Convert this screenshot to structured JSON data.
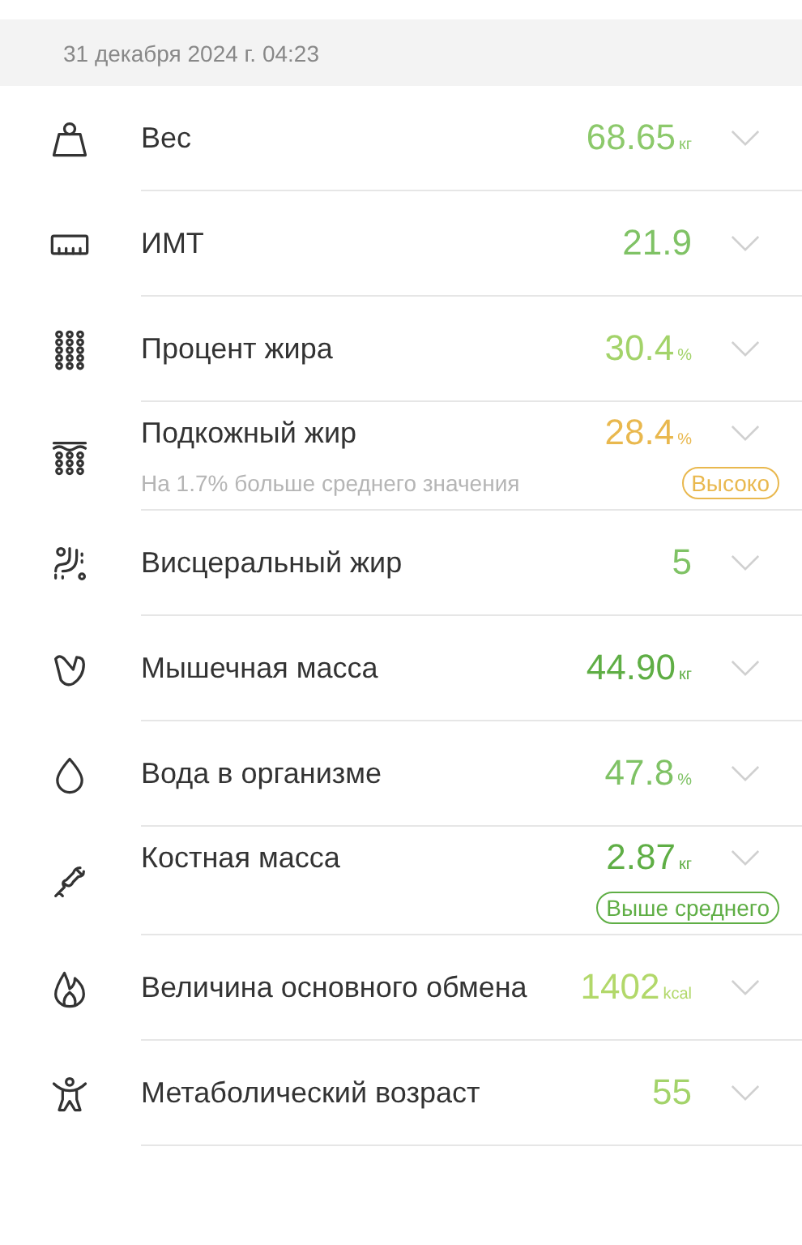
{
  "header": {
    "date": "31 декабря 2024 г. 04:23"
  },
  "metrics": [
    {
      "name": "Вес",
      "value": "68.65",
      "unit": "кг",
      "color": "#8cc96b"
    },
    {
      "name": "ИМТ",
      "value": "21.9",
      "color": "#7fc265"
    },
    {
      "name": "Процент жира",
      "value": "30.4",
      "unit": "%",
      "color": "#a3d36a"
    },
    {
      "name": "Подкожный жир",
      "value": "28.4",
      "unit": "%",
      "color": "#e9b84e",
      "note": "На 1.7% больше среднего значения",
      "badge": "Высоко"
    },
    {
      "name": "Висцеральный жир",
      "value": "5",
      "color": "#7fc265"
    },
    {
      "name": "Мышечная масса",
      "value": "44.90",
      "unit": "кг",
      "color": "#5fae45"
    },
    {
      "name": "Вода в организме",
      "value": "47.8",
      "unit": "%",
      "color": "#7fc265"
    },
    {
      "name": "Костная масса",
      "value": "2.87",
      "unit": "кг",
      "color": "#5fae45",
      "badge": "Выше среднего"
    },
    {
      "name": "Величина основного обмена",
      "value": "1402",
      "unit": "kcal",
      "color": "#b2d86a"
    },
    {
      "name": "Метаболический возраст",
      "value": "55",
      "color": "#a3d36a"
    }
  ]
}
